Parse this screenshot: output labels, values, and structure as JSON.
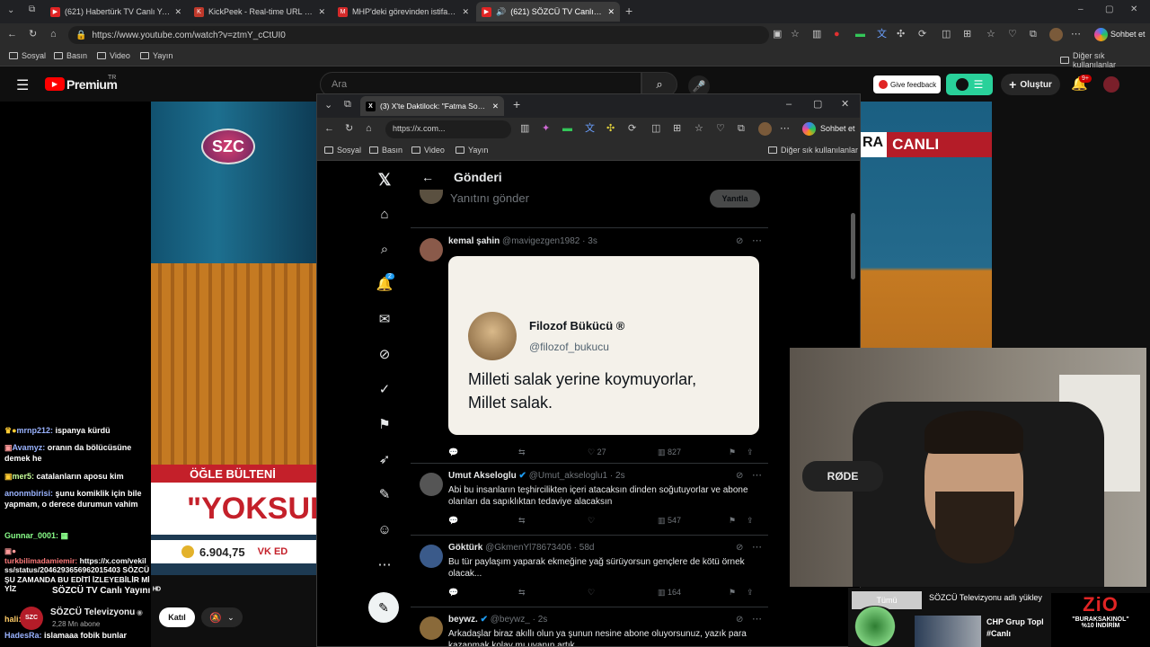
{
  "outer_browser": {
    "tabs": [
      {
        "title": "(621) Habertürk TV Canlı Yayın ᴴᴰ",
        "favicon": "youtube-icon",
        "color": "#e02424"
      },
      {
        "title": "KickPeek - Real-time URL Crawler",
        "favicon": "kickpeek-icon",
        "color": "#c0392b"
      },
      {
        "title": "MHP'deki görevinden istifa etmişt",
        "favicon": "news-icon",
        "color": "#d42a2a"
      },
      {
        "title": "(621) SÖZCÜ TV Canlı Yayını ᴴᴰ",
        "favicon": "youtube-icon",
        "color": "#e02424"
      }
    ],
    "address": "https://www.youtube.com/watch?v=ztmY_cCtUI0",
    "copilot_label": "Sohbet et",
    "bookmarks": [
      "Sosyal",
      "Basın",
      "Video",
      "Yayın"
    ],
    "other_bookmarks": "Diğer sık kullanılanlar"
  },
  "youtube": {
    "logo": "Premium",
    "logo_sup": "TR",
    "search_placeholder": "Ara",
    "feedback_label": "Give feedback",
    "create_label": "Oluştur",
    "notif_badge": "9+",
    "channel_name": "SÖZCÜ Televizyonu",
    "subscribers": "2,28 Mn abone",
    "join_label": "Katıl",
    "overlay_title": "SÖZCÜ TV Canlı Yayını ᴴᴰ"
  },
  "video": {
    "logo": "SZC",
    "live_badge": "CANLI",
    "badge_prefix": "RA",
    "program": "ÖĞLE BÜLTENİ",
    "headline": "\"YOKSUL",
    "gold_price": "6.904,75",
    "ticker_right": "VK ED",
    "accent": "#d0232a"
  },
  "chat": [
    {
      "user": "mrnp212:",
      "text": "ispanya kürdü",
      "user_color": "#9ab3ff"
    },
    {
      "user": "Avamyz:",
      "text": "oranın da bölücüsüne demek he",
      "user_color": "#9ab3ff"
    },
    {
      "user": "mer5:",
      "text": "catalanların aposu kim",
      "user_color": "#c8ff9a"
    },
    {
      "user": "anonmbirisi:",
      "text": "şunu komiklik için bile yapmam, o derece durumun vahim",
      "user_color": "#9ab3ff"
    },
    {
      "user": "Gunnar_0001:",
      "text": "",
      "user_color": "#8aff8a"
    },
    {
      "user": "turkbilimadamiemir:",
      "text": "https://x.com/vekilss/status/2046293656962015403 SÖZCÜ ŞU ZAMANDA BU EDİTİ İZLEYEBİLİR MİYİZ",
      "user_color": "#ff7b7b"
    },
    {
      "user": "hali:",
      "text": "",
      "user_color": "#ffcc66"
    },
    {
      "user": "HadesRa:",
      "text": "islamaaa fobik bunlar",
      "user_color": "#9ab3ff"
    }
  ],
  "inner_browser": {
    "tab_title": "(3) X'te Daktilock: \"Fatma Soydaş,",
    "address": "https://x.com...",
    "copilot_label": "Sohbet et",
    "bookmarks": [
      "Sosyal",
      "Basın",
      "Video",
      "Yayın"
    ],
    "other_bookmarks": "Diğer sık kullanılanlar"
  },
  "twitter": {
    "page_title": "Gönderi",
    "reply_placeholder": "Yanıtını gönder",
    "reply_button": "Yanıtla",
    "notification_count": "2",
    "tweets": [
      {
        "name": "kemal şahin",
        "handle": "@mavigezgen1982 · 3s",
        "text": "",
        "replies": "",
        "retweets": "",
        "likes": "27",
        "views": "827",
        "quote": {
          "name": "Filozof Bükücü ®",
          "handle": "@filozof_bukucu",
          "text": "Milleti salak yerine koymuyorlar, Millet salak."
        }
      },
      {
        "name": "Umut Akseloglu",
        "handle": "@Umut_akseloglu1 · 2s",
        "text": "Abi bu insanların teşhircilikten içeri atacaksın dinden soğutuyorlar ve abone olanları da sapıklıktan tedaviye alacaksın",
        "likes": "",
        "views": "547"
      },
      {
        "name": "Göktürk",
        "handle": "@GkmenYl78673406 · 58d",
        "text": "Bu tür paylaşım yaparak ekmeğine yağ sürüyorsun gençlere de kötü örnek olacak...",
        "likes": "",
        "views": "164"
      },
      {
        "name": "beywz.",
        "handle": "@beywz_ · 2s",
        "text": "Arkadaşlar biraz akıllı olun ya şunun nesine abone oluyorsunuz, yazık para kazanmak kolay mı uyanın artık"
      }
    ]
  },
  "webcam": {
    "mic_brand": "RØDE"
  },
  "lower_ticker": {
    "label": "Tümü",
    "channel_text": "SÖZCÜ Televizyonu adlı yükley",
    "video_title_1": "CHP Grup Topl",
    "video_title_2": "#Canlı",
    "sponsor_logo": "ZiO",
    "sponsor_code": "\"BURAKSAKINOL\"",
    "sponsor_discount": "%10 İNDİRİM"
  }
}
